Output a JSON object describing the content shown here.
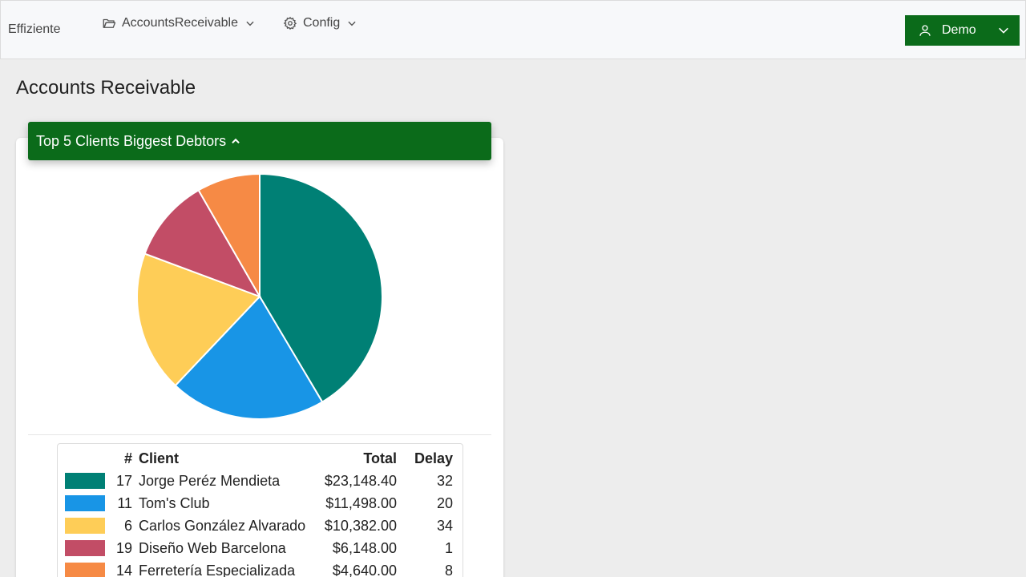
{
  "navbar": {
    "brand": "Effiziente",
    "menus": [
      {
        "label": "AccountsReceivable",
        "icon": "folder-open-icon"
      },
      {
        "label": "Config",
        "icon": "gear-icon"
      }
    ],
    "user": {
      "label": "Demo",
      "icon": "user-icon",
      "color": "#0b6b1a"
    }
  },
  "page": {
    "title": "Accounts Receivable"
  },
  "card": {
    "header": "Top 5 Clients Biggest Debtors",
    "header_color": "#0b6b1a"
  },
  "chart_data": {
    "type": "pie",
    "categories": [
      "Jorge Peréz Mendieta",
      "Tom's Club",
      "Carlos González Alvarado",
      "Diseño Web Barcelona",
      "Ferretería Especializada"
    ],
    "values": [
      23148.4,
      11498.0,
      10382.0,
      6148.0,
      4640.0
    ],
    "colors": [
      "#008075",
      "#1895e6",
      "#fecd57",
      "#c24d66",
      "#f68a45"
    ]
  },
  "table": {
    "headers": {
      "id": "#",
      "client": "Client",
      "total": "Total",
      "delay": "Delay"
    },
    "rows": [
      {
        "id": "17",
        "client": "Jorge Peréz Mendieta",
        "total": "$23,148.40",
        "delay": "32",
        "color": "#008075"
      },
      {
        "id": "11",
        "client": "Tom's Club",
        "total": "$11,498.00",
        "delay": "20",
        "color": "#1895e6"
      },
      {
        "id": "6",
        "client": "Carlos González Alvarado",
        "total": "$10,382.00",
        "delay": "34",
        "color": "#fecd57"
      },
      {
        "id": "19",
        "client": "Diseño Web Barcelona",
        "total": "$6,148.00",
        "delay": "1",
        "color": "#c24d66"
      },
      {
        "id": "14",
        "client": "Ferretería Especializada",
        "total": "$4,640.00",
        "delay": "8",
        "color": "#f68a45"
      }
    ]
  }
}
